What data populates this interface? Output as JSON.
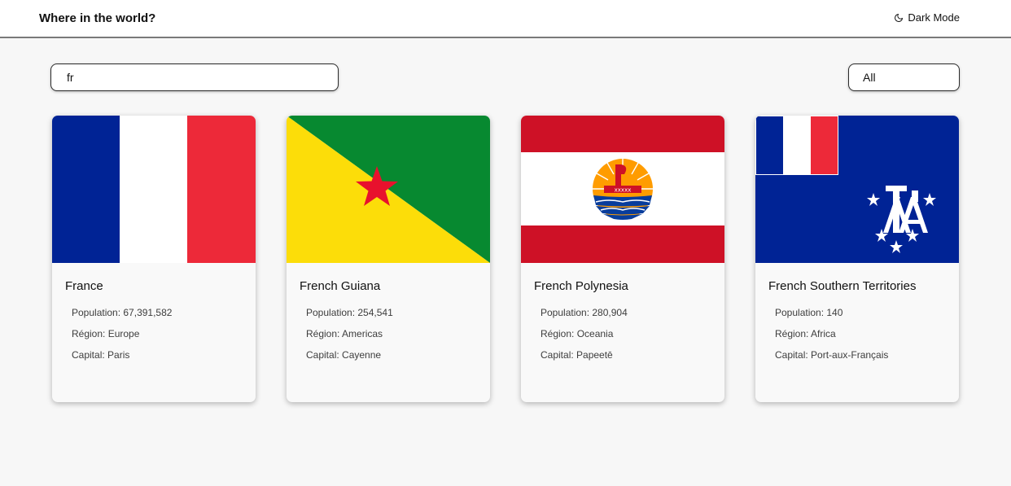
{
  "header": {
    "title": "Where in the world?",
    "dark_mode_label": "Dark Mode",
    "dark_mode_icon": "moon-icon"
  },
  "search": {
    "value": "fr"
  },
  "filter": {
    "selected": "All"
  },
  "colors": {
    "background": "#f7f7f7",
    "card": "#f9f9f9",
    "header": "#ffffff"
  },
  "countries": [
    {
      "name": "France",
      "population": "Population: 67,391,582",
      "region": "Région: Europe",
      "capital": "Capital: Paris",
      "flag_icon": "france-flag"
    },
    {
      "name": "French Guiana",
      "population": "Population: 254,541",
      "region": "Région: Americas",
      "capital": "Capital: Cayenne",
      "flag_icon": "french-guiana-flag"
    },
    {
      "name": "French Polynesia",
      "population": "Population: 280,904",
      "region": "Région: Oceania",
      "capital": "Capital: Papeetē",
      "flag_icon": "french-polynesia-flag"
    },
    {
      "name": "French Southern Territories",
      "population": "Population: 140",
      "region": "Région: Africa",
      "capital": "Capital: Port-aux-Français",
      "flag_icon": "french-southern-territories-flag"
    }
  ]
}
